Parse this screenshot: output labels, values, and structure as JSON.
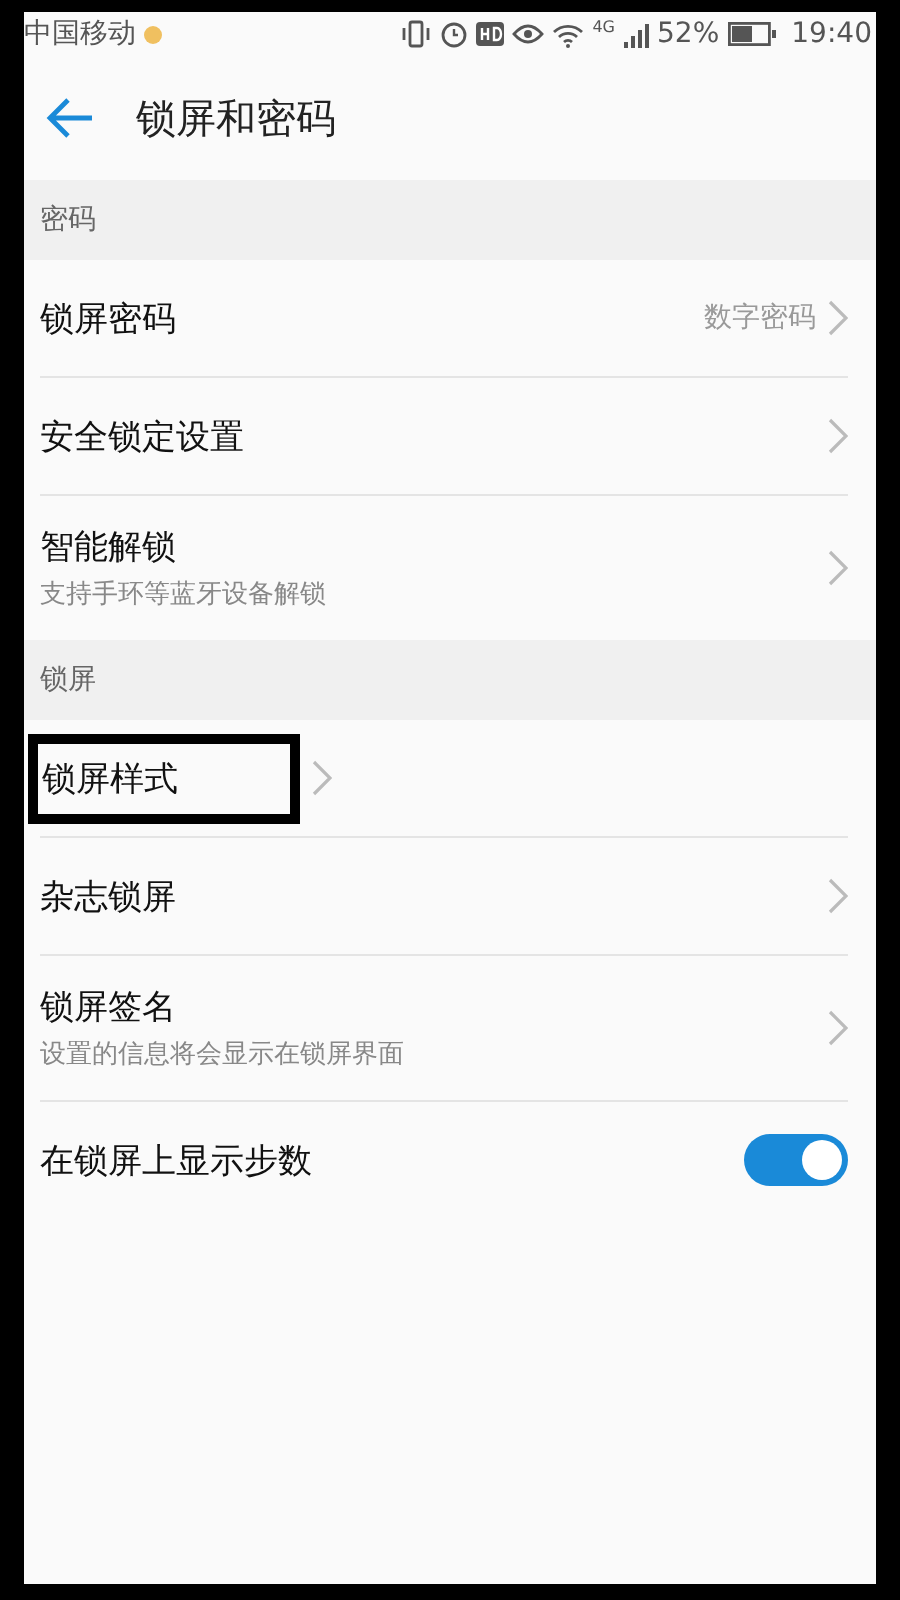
{
  "status_bar": {
    "carrier": "中国移动",
    "network": "4G",
    "battery": "52%",
    "time": "19:40"
  },
  "header": {
    "title": "锁屏和密码"
  },
  "sections": [
    {
      "title": "密码",
      "items": [
        {
          "kind": "link",
          "label": "锁屏密码",
          "value": "数字密码",
          "highlighted": false
        },
        {
          "kind": "link",
          "label": "安全锁定设置",
          "highlighted": false
        },
        {
          "kind": "link",
          "label": "智能解锁",
          "subtitle": "支持手环等蓝牙设备解锁",
          "highlighted": false
        }
      ]
    },
    {
      "title": "锁屏",
      "items": [
        {
          "kind": "link",
          "label": "锁屏样式",
          "highlighted": true
        },
        {
          "kind": "link",
          "label": "杂志锁屏",
          "highlighted": false
        },
        {
          "kind": "link",
          "label": "锁屏签名",
          "subtitle": "设置的信息将会显示在锁屏界面",
          "highlighted": false
        },
        {
          "kind": "toggle",
          "label": "在锁屏上显示步数",
          "on": true
        }
      ]
    }
  ]
}
